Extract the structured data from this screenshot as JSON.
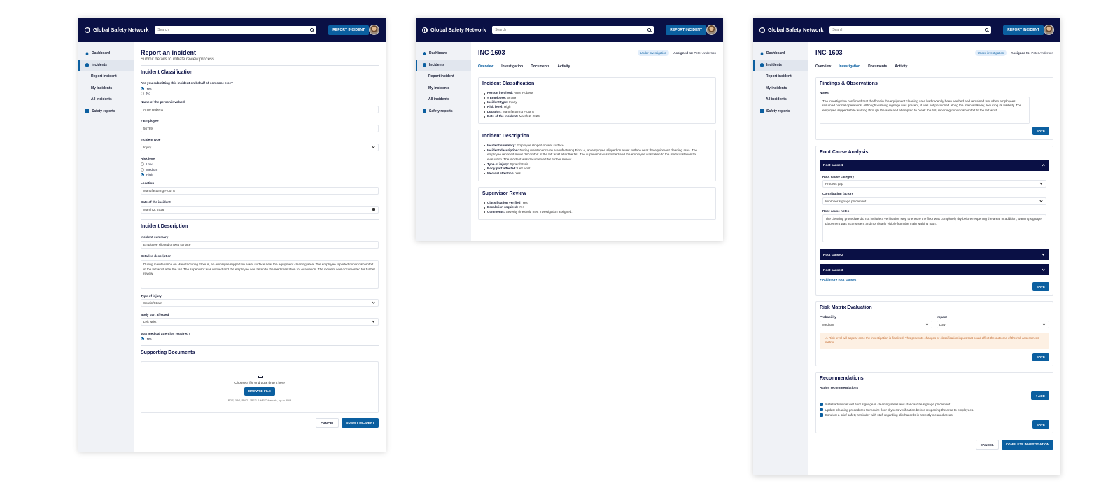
{
  "app": {
    "name": "Global Safety Network",
    "search_placeholder": "Search",
    "report_button": "REPORT INCIDENT"
  },
  "nav": {
    "dashboard": "Dashboard",
    "incidents": "Incidents",
    "report_incident": "Report incident",
    "my_incidents": "My incidents",
    "all_incidents": "All incidents",
    "safety_reports": "Safety reports"
  },
  "form": {
    "title": "Report an incident",
    "subtitle": "Submit details to initiate review process",
    "classification_heading": "Incident Classification",
    "behalf_q": "Are you submitting this incident on behalf of someone else?",
    "yes": "Yes",
    "no": "No",
    "person_label": "Name of the person involved",
    "person_value": "Anne Roberts",
    "employee_label": "# Employee",
    "employee_value": "56789",
    "type_label": "Incident type",
    "type_value": "Injury",
    "risk_label": "Risk level",
    "risk_low": "Low",
    "risk_medium": "Medium",
    "risk_high": "High",
    "location_label": "Location",
    "location_value": "Manufacturing Floor A",
    "date_label": "Date of the incident",
    "date_value": "March 2, 2026",
    "description_heading": "Incident Description",
    "summary_label": "Incident summary",
    "summary_value": "Employee slipped on wet surface",
    "detailed_label": "Detailed description",
    "detailed_value": "During maintenance on Manufacturing Floor A, an employee slipped on a wet surface near the equipment cleaning area. The employee reported minor discomfort in the left wrist after the fall. The supervisor was notified and the employee was taken to the medical station for evaluation. The incident was documented for further review.",
    "injury_label": "Type of injury",
    "injury_value": "Sprain/Strain",
    "body_label": "Body part affected",
    "body_value": "Left wrist",
    "medical_label": "Was medical attention required?",
    "medical_yes": "Yes",
    "docs_heading": "Supporting Documents",
    "drop_text": "Choose a file or drag & drop it here",
    "browse": "BROWSE FILE",
    "formats": "PDF, JPG, PNG, JPEG & HEIC formats, up to 5MB",
    "cancel": "CANCEL",
    "submit": "SUBMIT INCIDENT"
  },
  "incident": {
    "id": "INC-1603",
    "status": "Under investigation",
    "assigned_label": "Assigned to:",
    "assigned_name": "Peter Anderson",
    "tabs": [
      "Overview",
      "Investigation",
      "Documents",
      "Activity"
    ],
    "classification_heading": "Incident Classification",
    "classification": [
      {
        "k": "Person involved:",
        "v": "Anne Roberts"
      },
      {
        "k": "# Employee:",
        "v": "56789"
      },
      {
        "k": "Incident type:",
        "v": "Injury"
      },
      {
        "k": "Risk level:",
        "v": "High"
      },
      {
        "k": "Location:",
        "v": "Manufacturing Floor A"
      },
      {
        "k": "Date of the incident:",
        "v": "March 2, 2026"
      }
    ],
    "description_heading": "Incident Description",
    "description": [
      {
        "k": "Incident summary:",
        "v": "Employee slipped on wet surface"
      },
      {
        "k": "Incident description:",
        "v": "During maintenance on Manufacturing Floor A, an employee slipped on a wet surface near the equipment cleaning area. The employee reported minor discomfort in the left wrist after the fall. The supervisor was notified and the employee was taken to the medical station for evaluation. The incident was documented for further review."
      },
      {
        "k": "Type of injury:",
        "v": "Sprain/Strain"
      },
      {
        "k": "Body part affected:",
        "v": "Left wrist"
      },
      {
        "k": "Medical attention:",
        "v": "Yes"
      }
    ],
    "review_heading": "Supervisor Review",
    "review": [
      {
        "k": "Classification verified:",
        "v": "Yes"
      },
      {
        "k": "Escalation required:",
        "v": "Yes"
      },
      {
        "k": "Comments:",
        "v": "Severity threshold met. Investigation assigned."
      }
    ]
  },
  "investigation": {
    "findings_heading": "Findings & Observations",
    "notes_label": "Notes",
    "notes_value": "The investigation confirmed that the floor in the equipment cleaning area had recently been washed and remained wet when employees resumed normal operations. Although warning signage was present, it was not positioned along the main walkway, reducing its visibility. The employee slipped while walking through the area and attempted to break the fall, reporting minor discomfort to the left wrist.",
    "save": "SAVE",
    "rca_heading": "Root Cause Analysis",
    "rc1": "Root cause 1",
    "rc2": "Root cause 2",
    "rc3": "Root cause 3",
    "category_label": "Root cause category",
    "category_value": "Process gap",
    "factors_label": "Contributing factors",
    "factors_value": "Improper signage placement",
    "rc_notes_label": "Root cause notes",
    "rc_notes_value": "The cleaning procedure did not include a verification step to ensure the floor was completely dry before reopening the area. In addition, warning signage placement was inconsistent and not clearly visible from the main walking path.",
    "add_more": "Add more root causes",
    "matrix_heading": "Risk Matrix Evaluation",
    "probability_label": "Probability",
    "probability_value": "Medium",
    "impact_label": "Impact",
    "impact_value": "Low",
    "warning": "Risk level will appear once the investigation is finalized. This prevents changes or classification inputs that could affect the outcome of the risk assessment matrix.",
    "rec_heading": "Recommendations",
    "action_label": "Action recommendations",
    "add": "ADD",
    "actions": [
      "Install additional wet floor signage in cleaning areas and standardize signage placement.",
      "Update cleaning procedures to require floor dryness verification before reopening the area to employees.",
      "Conduct a brief safety reminder with staff regarding slip hazards in recently cleaned areas."
    ],
    "cancel": "CANCEL",
    "complete": "COMPLETE INVESTIGATION"
  },
  "colors": {
    "header": "#0a1045",
    "accent": "#0b5fa0",
    "warning_bg": "#fdf0e3",
    "warning_text": "#c0662a"
  }
}
